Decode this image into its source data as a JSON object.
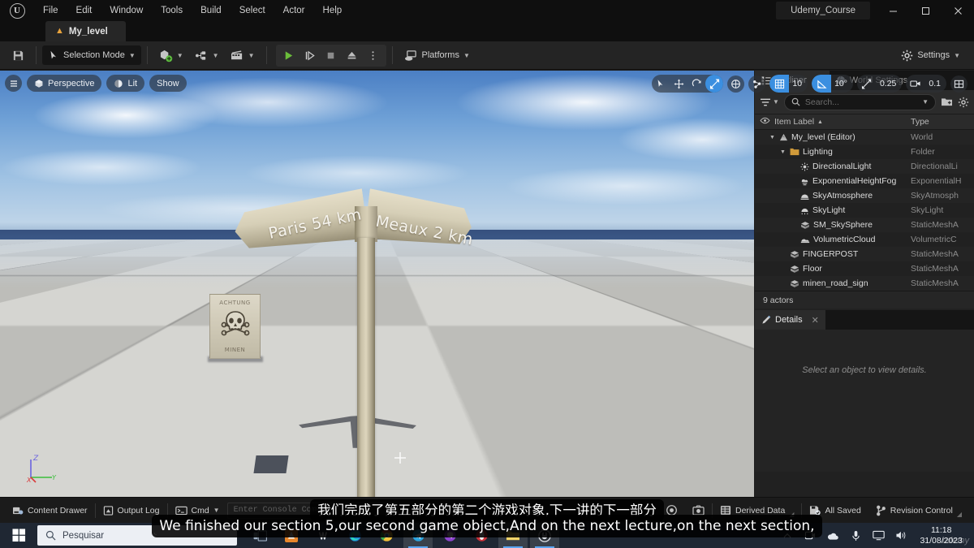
{
  "window": {
    "app_logo": "unreal-engine-logo",
    "project_title": "Udemy_Course",
    "minimize": "–",
    "maximize": "❐",
    "close": "✕",
    "menus": [
      "File",
      "Edit",
      "Window",
      "Tools",
      "Build",
      "Select",
      "Actor",
      "Help"
    ],
    "level_tab": "My_level"
  },
  "toolbar": {
    "save_icon": "save-icon",
    "selection_mode": "Selection Mode",
    "add_label": "add-actor-icon",
    "blueprints_label": "blueprints-icon",
    "cinematics_label": "cinematics-icon",
    "play": "play-icon",
    "skip": "skip-icon",
    "stop": "stop-icon",
    "eject": "eject-icon",
    "more": "more-options-icon",
    "platforms": "Platforms",
    "settings": "Settings"
  },
  "viewport": {
    "menu_icon": "viewport-menu-icon",
    "perspective": "Perspective",
    "lit": "Lit",
    "show": "Show",
    "transform_tools": [
      {
        "name": "select-tool",
        "active": false
      },
      {
        "name": "move-tool",
        "active": false
      },
      {
        "name": "rotate-tool",
        "active": false
      },
      {
        "name": "scale-tool",
        "active": true
      }
    ],
    "coordinate_system": "world-coordinate-icon",
    "surface_snap": "surface-snap-icon",
    "grid_snap_enabled": true,
    "grid_snap_value": "10",
    "angle_snap_enabled": true,
    "angle_snap_value": "10°",
    "scale_snap_value": "0.25",
    "camera_speed_value": "0.1",
    "layout_icon": "viewport-layout-icon",
    "axis_labels": {
      "x": "X",
      "y": "Y",
      "z": "Z"
    },
    "scene": {
      "signpost_left_text": "Paris 54 km",
      "signpost_right_text": "Meaux 2 km",
      "mine_sign_top_text": "ACHTUNG",
      "mine_sign_bottom_text": "MINEN"
    }
  },
  "outliner": {
    "tab_label": "Outliner",
    "tab_icon": "outliner-icon",
    "world_settings_tab": "World Settings",
    "world_settings_icon": "globe-icon",
    "close_icon": "✕",
    "filter_icon": "filter-icon",
    "search_icon": "search-icon",
    "search_value": "",
    "search_placeholder": "Search...",
    "new_folder_icon": "new-folder-icon",
    "settings_icon": "gear-icon",
    "columns": {
      "visibility": "eye-icon",
      "label": "Item Label",
      "sort": "▲",
      "type": "Type"
    },
    "rows": [
      {
        "label": "My_level (Editor)",
        "type": "World",
        "indent": 1,
        "expander": "▼",
        "icon": "level-icon"
      },
      {
        "label": "Lighting",
        "type": "Folder",
        "indent": 2,
        "expander": "▼",
        "icon": "folder-icon"
      },
      {
        "label": "DirectionalLight",
        "type": "DirectionalLi",
        "indent": 3,
        "expander": "",
        "icon": "directional-light-icon"
      },
      {
        "label": "ExponentialHeightFog",
        "type": "ExponentialH",
        "indent": 3,
        "expander": "",
        "icon": "fog-icon"
      },
      {
        "label": "SkyAtmosphere",
        "type": "SkyAtmosph",
        "indent": 3,
        "expander": "",
        "icon": "sky-atmosphere-icon"
      },
      {
        "label": "SkyLight",
        "type": "SkyLight",
        "indent": 3,
        "expander": "",
        "icon": "sky-light-icon"
      },
      {
        "label": "SM_SkySphere",
        "type": "StaticMeshA",
        "indent": 3,
        "expander": "",
        "icon": "static-mesh-icon"
      },
      {
        "label": "VolumetricCloud",
        "type": "VolumetricC",
        "indent": 3,
        "expander": "",
        "icon": "cloud-icon"
      },
      {
        "label": "FINGERPOST",
        "type": "StaticMeshA",
        "indent": 2,
        "expander": "",
        "icon": "static-mesh-icon"
      },
      {
        "label": "Floor",
        "type": "StaticMeshA",
        "indent": 2,
        "expander": "",
        "icon": "static-mesh-icon"
      },
      {
        "label": "minen_road_sign",
        "type": "StaticMeshA",
        "indent": 2,
        "expander": "",
        "icon": "static-mesh-icon"
      }
    ],
    "actor_count": "9 actors"
  },
  "details": {
    "tab_label": "Details",
    "tab_icon": "details-icon",
    "close_icon": "✕",
    "empty_hint": "Select an object to view details."
  },
  "statusbar": {
    "content_drawer": "Content Drawer",
    "content_drawer_icon": "drawer-icon",
    "output_log": "Output Log",
    "output_log_icon": "log-icon",
    "cmd": "Cmd",
    "cmd_icon": "console-icon",
    "console_placeholder": "Enter Console Command",
    "record_icon": "record-icon",
    "screenshot_icon": "screenshot-icon",
    "derived_data": "Derived Data",
    "derived_data_icon": "database-icon",
    "all_saved": "All Saved",
    "all_saved_icon": "saved-icon",
    "revision_control": "Revision Control",
    "revision_control_icon": "branch-icon"
  },
  "subtitles": {
    "chinese": "我们完成了第五部分的第二个游戏对象,下一讲的下一部分",
    "english": "We finished our section 5,our second game object,And on the next lecture,on the next section,"
  },
  "taskbar": {
    "start_icon": "windows-start-icon",
    "search_placeholder": "Pesquisar",
    "search_icon": "search-icon",
    "apps": [
      {
        "name": "task-view-icon",
        "color": "#9fb0c4",
        "active": false
      },
      {
        "name": "vlc-icon",
        "color": "#e8862a",
        "active": false
      },
      {
        "name": "word-icon",
        "color": "#e8eef5",
        "active": false
      },
      {
        "name": "edge-icon",
        "color": "#1e7fd6",
        "active": false
      },
      {
        "name": "chrome-icon",
        "color": "#3fa94e",
        "active": false
      },
      {
        "name": "telegram-icon",
        "color": "#2ca5e0",
        "active": true
      },
      {
        "name": "viber-icon",
        "color": "#8e44d0",
        "active": false
      },
      {
        "name": "opera-icon",
        "color": "#d0323a",
        "active": false
      },
      {
        "name": "folder-icon",
        "color": "#e8c54a",
        "active": true
      },
      {
        "name": "unreal-engine-icon",
        "color": "#d8dce2",
        "active": true
      }
    ],
    "tray": [
      "chevron-up-icon",
      "camera-icon",
      "onedrive-icon",
      "mic-icon",
      "display-icon",
      "volume-icon"
    ],
    "time": "11:18",
    "date": "31/08/2023",
    "watermark": "udemy"
  },
  "colors": {
    "accent_blue": "#3b8fe0",
    "play_green": "#6bbd3a",
    "panel_bg": "#242424",
    "titlebar_bg": "#0f0f0f",
    "taskbar_bg": "#1f2733"
  }
}
